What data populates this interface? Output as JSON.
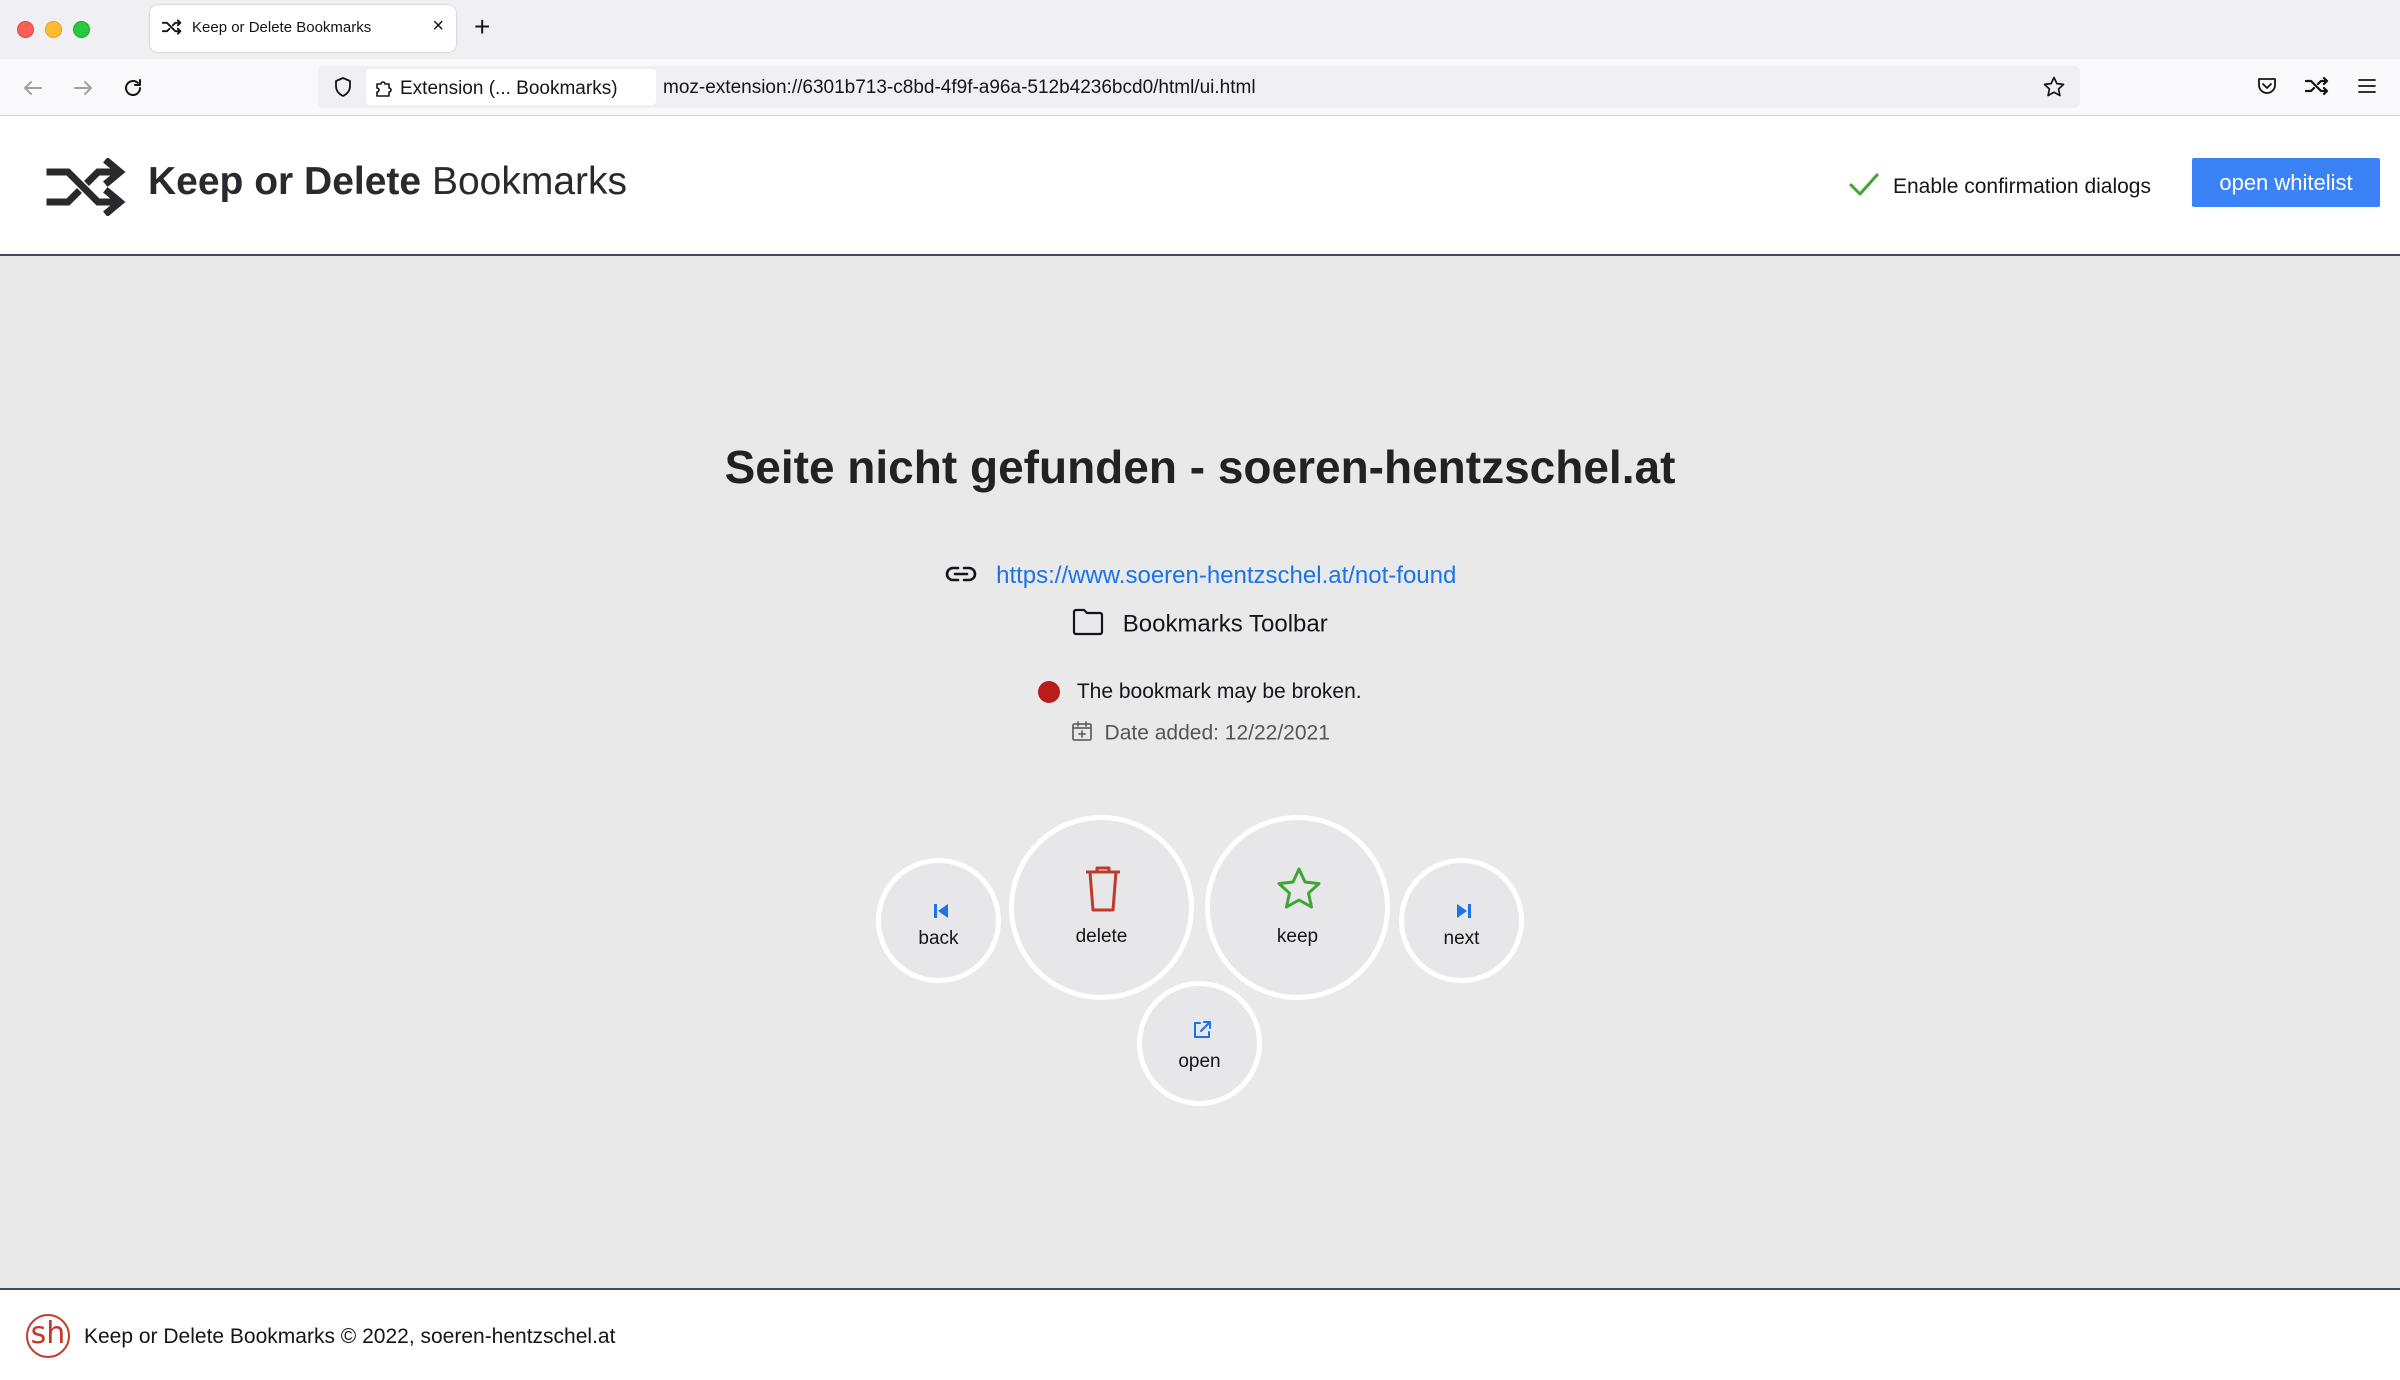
{
  "browser": {
    "tab_title": "Keep or Delete Bookmarks",
    "url_chip": "Extension (... Bookmarks)",
    "url": "moz-extension://6301b713-c8bd-4f9f-a96a-512b4236bcd0/html/ui.html"
  },
  "header": {
    "title_bold": "Keep or Delete",
    "title_light": "Bookmarks",
    "confirm_label": "Enable confirmation dialogs",
    "confirm_checked": true,
    "whitelist_button": "open whitelist"
  },
  "bookmark": {
    "title": "Seite nicht gefunden - soeren-hentzschel.at",
    "url": "https://www.soeren-hentzschel.at/not-found",
    "folder": "Bookmarks Toolbar",
    "status": "The bookmark may be broken.",
    "status_color": "#b91c1c",
    "date_added": "Date added: 12/22/2021"
  },
  "actions": {
    "back": "back",
    "delete": "delete",
    "keep": "keep",
    "next": "next",
    "open": "open"
  },
  "colors": {
    "accent": "#3b82f6",
    "delete": "#c0392b",
    "keep": "#3fa535",
    "link": "#1a73e8"
  },
  "footer": {
    "logo_text": "sh",
    "text": "Keep or Delete Bookmarks © 2022, soeren-hentzschel.at"
  }
}
